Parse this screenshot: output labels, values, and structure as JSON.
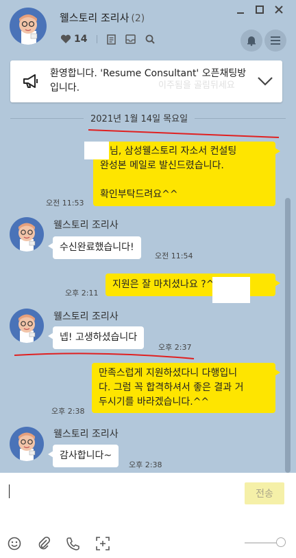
{
  "header": {
    "title": "웰스토리 조리사",
    "member_count": "(2)",
    "heart_count": "14",
    "icons": [
      "heart-icon",
      "notes-icon",
      "inbox-icon",
      "search-icon",
      "bell-icon",
      "menu-icon"
    ],
    "window_controls": [
      "minimize-icon",
      "maximize-icon",
      "close-icon"
    ]
  },
  "notice": {
    "text": "환영합니다. 'Resume Consultant' 오픈채팅방입니다.",
    "ghost_text": "이주됨을 골림뒤세요"
  },
  "date_divider": "2021년 1월 14일 목요일",
  "messages": [
    {
      "from": "me",
      "lines": [
        "님, 삼성웰스토리 자소서 컨설팅",
        "완성본 메일로 발신드렸습니다.",
        "",
        "확인부탁드려요^^"
      ],
      "time": "오전 11:53"
    },
    {
      "from": "other",
      "sender": "웰스토리 조리사",
      "text": "수신완료했습니다!",
      "time": "오전 11:54"
    },
    {
      "from": "me",
      "text": "지원은 잘 마치셨나요         ?^^",
      "time": "오후 2:11"
    },
    {
      "from": "other",
      "sender": "웰스토리 조리사",
      "text": "넵! 고생하셨습니다",
      "time": "오후 2:37"
    },
    {
      "from": "me",
      "lines": [
        "만족스럽게 지원하셨다니 다행입니",
        "다. 그럼 꼭 합격하셔서 좋은 결과 거",
        "두시기를 바라겠습니다.^^"
      ],
      "time": "오후 2:38"
    },
    {
      "from": "other",
      "sender": "웰스토리 조리사",
      "text": "감사합니다~",
      "time": "오후 2:38"
    }
  ],
  "input": {
    "value": "",
    "send_label": "전송"
  },
  "toolbar": [
    "emoji-icon",
    "attach-icon",
    "phone-icon",
    "capture-icon"
  ],
  "colors": {
    "background": "#b2c7da",
    "my_bubble": "#fee500",
    "other_bubble": "#ffffff",
    "avatar_bg": "#4a73b8",
    "annotation_red": "#e02020"
  }
}
